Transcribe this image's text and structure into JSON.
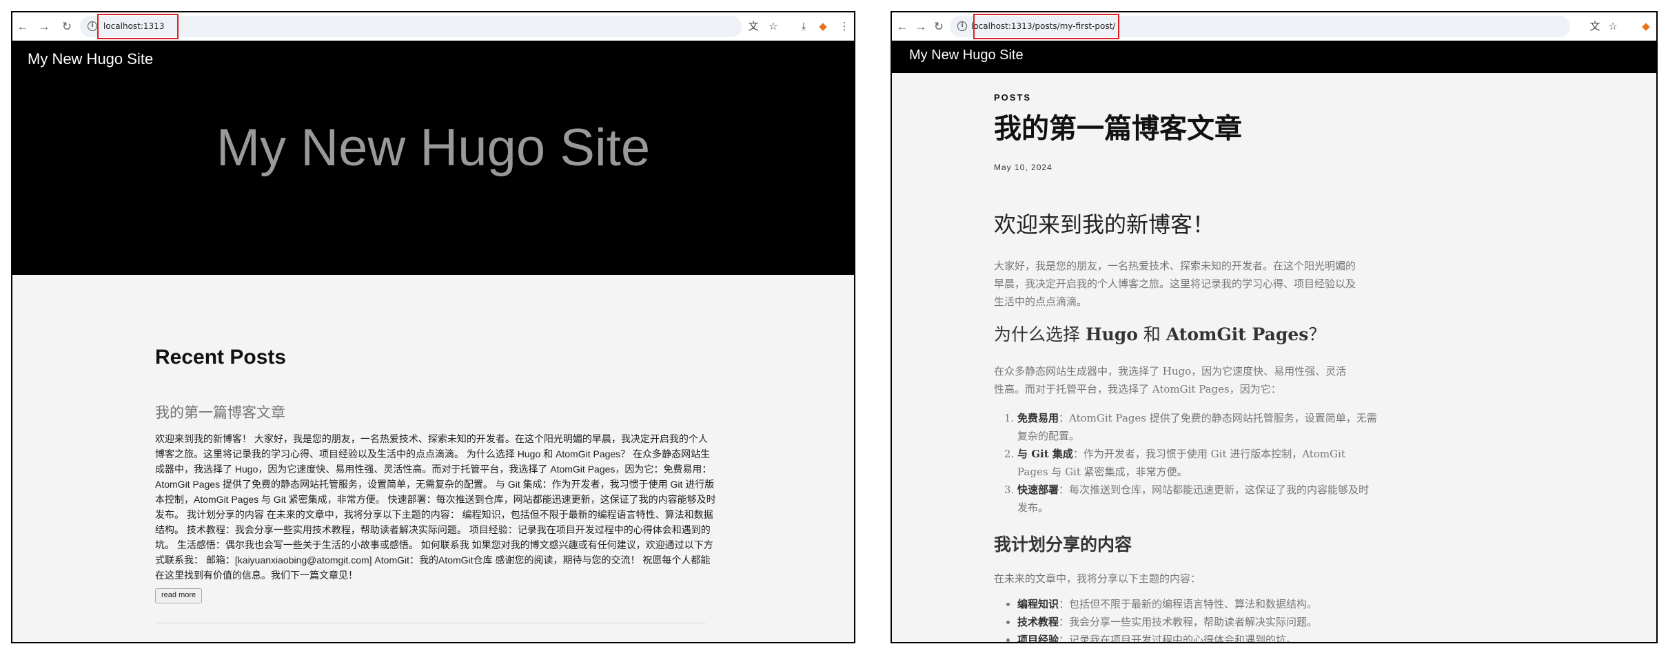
{
  "left_window": {
    "url": "localhost:1313",
    "site_name": "My New Hugo Site",
    "hero_title": "My New Hugo Site",
    "recent_posts_heading": "Recent Posts",
    "post_title": "我的第一篇博客文章",
    "post_excerpt": "欢迎来到我的新博客！ 大家好，我是您的朋友，一名热爱技术、探索未知的开发者。在这个阳光明媚的早晨，我决定开启我的个人博客之旅。这里将记录我的学习心得、项目经验以及生活中的点点滴滴。 为什么选择 Hugo 和 AtomGit Pages？ 在众多静态网站生成器中，我选择了 Hugo，因为它速度快、易用性强、灵活性高。而对于托管平台，我选择了 AtomGit Pages，因为它：免费易用：AtomGit Pages 提供了免费的静态网站托管服务，设置简单，无需复杂的配置。 与 Git 集成：作为开发者，我习惯于使用 Git 进行版本控制，AtomGit Pages 与 Git 紧密集成，非常方便。 快速部署：每次推送到仓库，网站都能迅速更新，这保证了我的内容能够及时发布。 我计划分享的内容 在未来的文章中，我将分享以下主题的内容： 编程知识，包括但不限于最新的编程语言特性、算法和数据结构。 技术教程：我会分享一些实用技术教程，帮助读者解决实际问题。 项目经验：记录我在项目开发过程中的心得体会和遇到的坑。 生活感悟：偶尔我也会写一些关于生活的小故事或感悟。 如何联系我 如果您对我的博文感兴趣或有任何建议，欢迎通过以下方式联系我： 邮箱：[kaiyuanxiaobing@atomgit.com] AtomGit：我的AtomGit仓库 感谢您的阅读，期待与您的交流！ 祝愿每个人都能在这里找到有价值的信息。我们下一篇文章见！",
    "read_more": "read more"
  },
  "right_window": {
    "url": "localhost:1313/posts/my-first-post/",
    "site_name": "My New Hugo Site",
    "section": "POSTS",
    "title": "我的第一篇博客文章",
    "date": "May 10, 2024",
    "heading1": "欢迎来到我的新博客！",
    "para1": "大家好，我是您的朋友，一名热爱技术、探索未知的开发者。在这个阳光明媚的早晨，我决定开启我的个人博客之旅。这里将记录我的学习心得、项目经验以及生活中的点点滴滴。",
    "heading2_pre": "为什么选择 ",
    "heading2_hugo": "Hugo",
    "heading2_mid": " 和 ",
    "heading2_atom": "AtomGit Pages",
    "heading2_post": "？",
    "para2": "在众多静态网站生成器中，我选择了 Hugo，因为它速度快、易用性强、灵活性高。而对于托管平台，我选择了 AtomGit Pages，因为它：",
    "reasons": [
      {
        "label": "免费易用",
        "text": "：AtomGit Pages 提供了免费的静态网站托管服务，设置简单，无需复杂的配置。"
      },
      {
        "label": "与 Git 集成",
        "text": "：作为开发者，我习惯于使用 Git 进行版本控制，AtomGit Pages 与 Git 紧密集成，非常方便。"
      },
      {
        "label": "快速部署",
        "text": "：每次推送到仓库，网站都能迅速更新，这保证了我的内容能够及时发布。"
      }
    ],
    "heading3": "我计划分享的内容",
    "para3": "在未来的文章中，我将分享以下主题的内容：",
    "topics": [
      {
        "label": "编程知识",
        "text": "：包括但不限于最新的编程语言特性、算法和数据结构。"
      },
      {
        "label": "技术教程",
        "text": "：我会分享一些实用技术教程，帮助读者解决实际问题。"
      },
      {
        "label": "项目经验",
        "text": "：记录我在项目开发过程中的心得体会和遇到的坑。"
      }
    ]
  },
  "icons": {
    "back": "arrow-left-icon",
    "forward": "arrow-right-icon",
    "reload": "reload-icon",
    "site_info": "info-icon",
    "translate": "translate-icon",
    "bookmark": "star-icon",
    "download": "download-icon",
    "extension": "fox-icon",
    "menu": "more-vertical-icon"
  },
  "colors": {
    "url_highlight": "#e02020",
    "header_bg": "#000000",
    "hero_title": "#999999",
    "page_bg": "#f4f4f4"
  }
}
